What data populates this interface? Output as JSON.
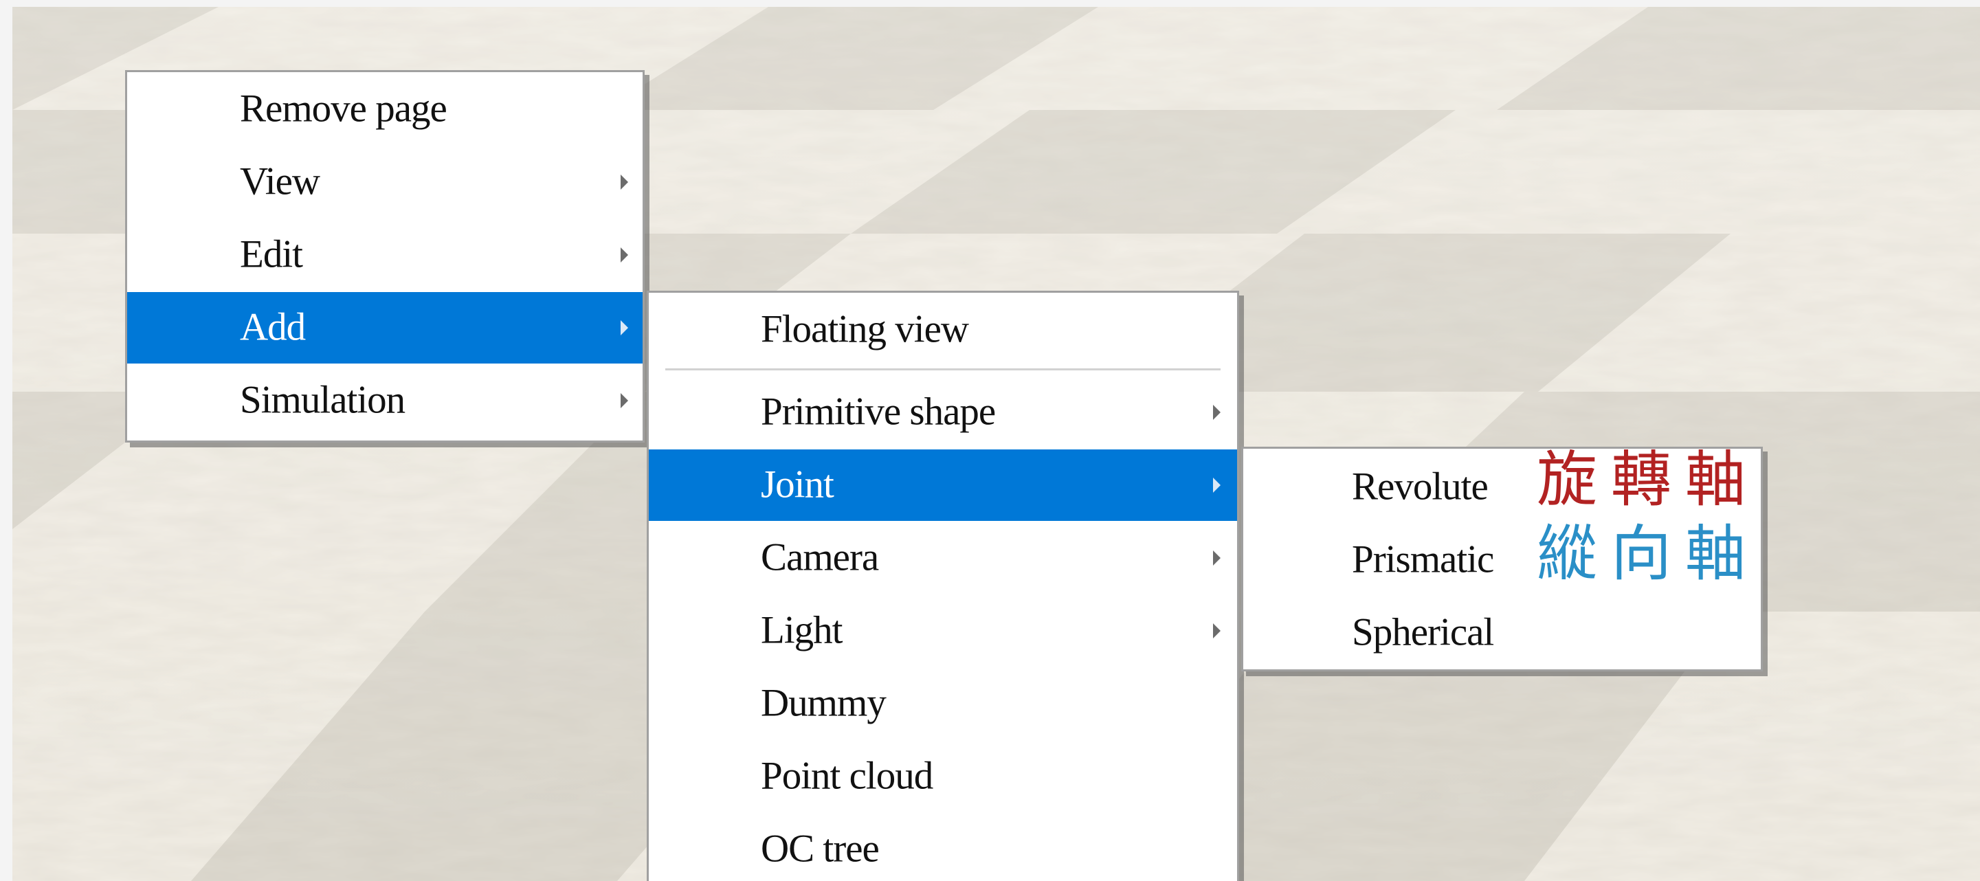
{
  "menu": {
    "items": [
      {
        "label": "Remove page"
      },
      {
        "label": "View"
      },
      {
        "label": "Edit"
      },
      {
        "label": "Add"
      },
      {
        "label": "Simulation"
      }
    ]
  },
  "add_menu": {
    "items": [
      {
        "label": "Floating view"
      },
      {
        "label": "Primitive shape"
      },
      {
        "label": "Joint"
      },
      {
        "label": "Camera"
      },
      {
        "label": "Light"
      },
      {
        "label": "Dummy"
      },
      {
        "label": "Point cloud"
      },
      {
        "label": "OC tree"
      }
    ]
  },
  "joint_menu": {
    "items": [
      {
        "label": "Revolute"
      },
      {
        "label": "Prismatic"
      },
      {
        "label": "Spherical"
      }
    ]
  },
  "annotations": {
    "revolute": "旋轉軸",
    "prismatic": "縱向軸"
  },
  "colors": {
    "highlight": "#0078d7",
    "annotation_revolute": "#b22222",
    "annotation_prismatic": "#2a8fc7"
  }
}
